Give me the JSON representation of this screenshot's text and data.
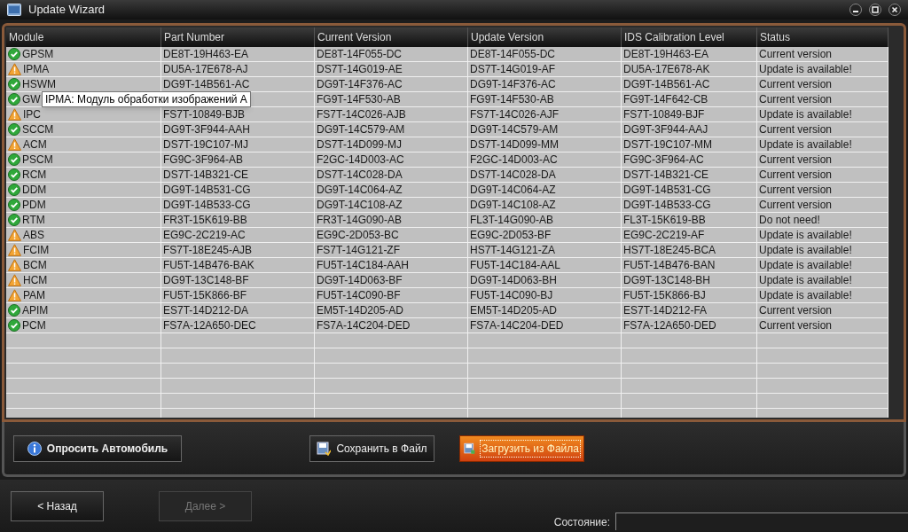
{
  "window": {
    "title": "Update Wizard"
  },
  "table": {
    "columns": [
      "Module",
      "Part Number",
      "Current Version",
      "Update Version",
      "IDS Calibration Level",
      "Status"
    ],
    "rows": [
      {
        "kind": "ok",
        "cells": [
          "GPSM",
          "DE8T-19H463-EA",
          "DE8T-14F055-DC",
          "DE8T-14F055-DC",
          "DE8T-19H463-EA",
          "Current version"
        ]
      },
      {
        "kind": "warning",
        "cells": [
          "IPMA",
          "DU5A-17E678-AJ",
          "DS7T-14G019-AE",
          "DS7T-14G019-AF",
          "DU5A-17E678-AK",
          "Update is available!"
        ]
      },
      {
        "kind": "ok",
        "cells": [
          "HSWM",
          "DG9T-14B561-AC",
          "DG9T-14F376-AC",
          "DG9T-14F376-AC",
          "DG9T-14B561-AC",
          "Current version"
        ]
      },
      {
        "kind": "ok",
        "cells": [
          "GW",
          "",
          "FG9T-14F530-AB",
          "FG9T-14F530-AB",
          "FG9T-14F642-CB",
          "Current version"
        ]
      },
      {
        "kind": "warning",
        "cells": [
          "IPC",
          "FS7T-10849-BJB",
          "FS7T-14C026-AJB",
          "FS7T-14C026-AJF",
          "FS7T-10849-BJF",
          "Update is available!"
        ]
      },
      {
        "kind": "ok",
        "cells": [
          "SCCM",
          "DG9T-3F944-AAH",
          "DG9T-14C579-AM",
          "DG9T-14C579-AM",
          "DG9T-3F944-AAJ",
          "Current version"
        ]
      },
      {
        "kind": "warning",
        "cells": [
          "ACM",
          "DS7T-19C107-MJ",
          "DS7T-14D099-MJ",
          "DS7T-14D099-MM",
          "DS7T-19C107-MM",
          "Update is available!"
        ]
      },
      {
        "kind": "ok",
        "cells": [
          "PSCM",
          "FG9C-3F964-AB",
          "F2GC-14D003-AC",
          "F2GC-14D003-AC",
          "FG9C-3F964-AC",
          "Current version"
        ]
      },
      {
        "kind": "ok",
        "cells": [
          "RCM",
          "DS7T-14B321-CE",
          "DS7T-14C028-DA",
          "DS7T-14C028-DA",
          "DS7T-14B321-CE",
          "Current version"
        ]
      },
      {
        "kind": "ok",
        "cells": [
          "DDM",
          "DG9T-14B531-CG",
          "DG9T-14C064-AZ",
          "DG9T-14C064-AZ",
          "DG9T-14B531-CG",
          "Current version"
        ]
      },
      {
        "kind": "ok",
        "cells": [
          "PDM",
          "DG9T-14B533-CG",
          "DG9T-14C108-AZ",
          "DG9T-14C108-AZ",
          "DG9T-14B533-CG",
          "Current version"
        ]
      },
      {
        "kind": "ok",
        "cells": [
          "RTM",
          "FR3T-15K619-BB",
          "FR3T-14G090-AB",
          "FL3T-14G090-AB",
          "FL3T-15K619-BB",
          "Do not need!"
        ]
      },
      {
        "kind": "warning",
        "cells": [
          "ABS",
          "EG9C-2C219-AC",
          "EG9C-2D053-BC",
          "EG9C-2D053-BF",
          "EG9C-2C219-AF",
          "Update is available!"
        ]
      },
      {
        "kind": "warning",
        "cells": [
          "FCIM",
          "FS7T-18E245-AJB",
          "FS7T-14G121-ZF",
          "HS7T-14G121-ZA",
          "HS7T-18E245-BCA",
          "Update is available!"
        ]
      },
      {
        "kind": "warning",
        "cells": [
          "BCM",
          "FU5T-14B476-BAK",
          "FU5T-14C184-AAH",
          "FU5T-14C184-AAL",
          "FU5T-14B476-BAN",
          "Update is available!"
        ]
      },
      {
        "kind": "warning",
        "cells": [
          "HCM",
          "DG9T-13C148-BF",
          "DG9T-14D063-BF",
          "DG9T-14D063-BH",
          "DG9T-13C148-BH",
          "Update is available!"
        ]
      },
      {
        "kind": "warning",
        "cells": [
          "PAM",
          "FU5T-15K866-BF",
          "FU5T-14C090-BF",
          "FU5T-14C090-BJ",
          "FU5T-15K866-BJ",
          "Update is available!"
        ]
      },
      {
        "kind": "ok",
        "cells": [
          "APIM",
          "ES7T-14D212-DA",
          "EM5T-14D205-AD",
          "EM5T-14D205-AD",
          "ES7T-14D212-FA",
          "Current version"
        ]
      },
      {
        "kind": "ok",
        "cells": [
          "PCM",
          "FS7A-12A650-DEC",
          "FS7A-14C204-DED",
          "FS7A-14C204-DED",
          "FS7A-12A650-DED",
          "Current version"
        ]
      }
    ]
  },
  "tooltip": {
    "text": "IPMA: Модуль обработки изображений А"
  },
  "actions": [
    {
      "kind": "info",
      "label": "Опросить Автомобиль",
      "highlighted": false
    },
    {
      "kind": "save",
      "label": "Сохранить в Файл",
      "highlighted": false
    },
    {
      "kind": "load",
      "label": "Загрузить из Файла",
      "highlighted": true
    }
  ],
  "navigation": [
    {
      "label": "< Назад",
      "disabled": false
    },
    {
      "label": "Далее >",
      "disabled": true
    }
  ],
  "status_bar": {
    "label": "Состояние:"
  }
}
